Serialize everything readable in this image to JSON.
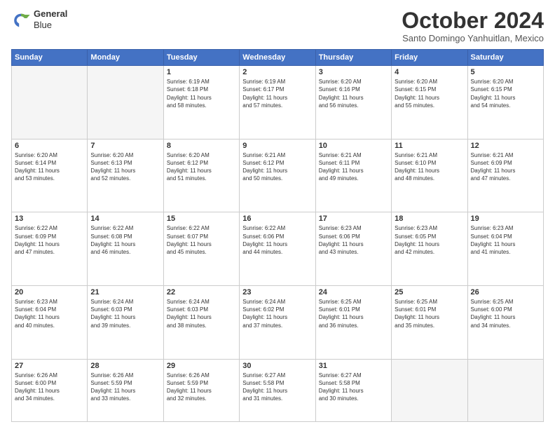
{
  "logo": {
    "line1": "General",
    "line2": "Blue"
  },
  "header": {
    "title": "October 2024",
    "subtitle": "Santo Domingo Yanhuitlan, Mexico"
  },
  "weekdays": [
    "Sunday",
    "Monday",
    "Tuesday",
    "Wednesday",
    "Thursday",
    "Friday",
    "Saturday"
  ],
  "weeks": [
    [
      {
        "day": "",
        "info": ""
      },
      {
        "day": "",
        "info": ""
      },
      {
        "day": "1",
        "info": "Sunrise: 6:19 AM\nSunset: 6:18 PM\nDaylight: 11 hours\nand 58 minutes."
      },
      {
        "day": "2",
        "info": "Sunrise: 6:19 AM\nSunset: 6:17 PM\nDaylight: 11 hours\nand 57 minutes."
      },
      {
        "day": "3",
        "info": "Sunrise: 6:20 AM\nSunset: 6:16 PM\nDaylight: 11 hours\nand 56 minutes."
      },
      {
        "day": "4",
        "info": "Sunrise: 6:20 AM\nSunset: 6:15 PM\nDaylight: 11 hours\nand 55 minutes."
      },
      {
        "day": "5",
        "info": "Sunrise: 6:20 AM\nSunset: 6:15 PM\nDaylight: 11 hours\nand 54 minutes."
      }
    ],
    [
      {
        "day": "6",
        "info": "Sunrise: 6:20 AM\nSunset: 6:14 PM\nDaylight: 11 hours\nand 53 minutes."
      },
      {
        "day": "7",
        "info": "Sunrise: 6:20 AM\nSunset: 6:13 PM\nDaylight: 11 hours\nand 52 minutes."
      },
      {
        "day": "8",
        "info": "Sunrise: 6:20 AM\nSunset: 6:12 PM\nDaylight: 11 hours\nand 51 minutes."
      },
      {
        "day": "9",
        "info": "Sunrise: 6:21 AM\nSunset: 6:12 PM\nDaylight: 11 hours\nand 50 minutes."
      },
      {
        "day": "10",
        "info": "Sunrise: 6:21 AM\nSunset: 6:11 PM\nDaylight: 11 hours\nand 49 minutes."
      },
      {
        "day": "11",
        "info": "Sunrise: 6:21 AM\nSunset: 6:10 PM\nDaylight: 11 hours\nand 48 minutes."
      },
      {
        "day": "12",
        "info": "Sunrise: 6:21 AM\nSunset: 6:09 PM\nDaylight: 11 hours\nand 47 minutes."
      }
    ],
    [
      {
        "day": "13",
        "info": "Sunrise: 6:22 AM\nSunset: 6:09 PM\nDaylight: 11 hours\nand 47 minutes."
      },
      {
        "day": "14",
        "info": "Sunrise: 6:22 AM\nSunset: 6:08 PM\nDaylight: 11 hours\nand 46 minutes."
      },
      {
        "day": "15",
        "info": "Sunrise: 6:22 AM\nSunset: 6:07 PM\nDaylight: 11 hours\nand 45 minutes."
      },
      {
        "day": "16",
        "info": "Sunrise: 6:22 AM\nSunset: 6:06 PM\nDaylight: 11 hours\nand 44 minutes."
      },
      {
        "day": "17",
        "info": "Sunrise: 6:23 AM\nSunset: 6:06 PM\nDaylight: 11 hours\nand 43 minutes."
      },
      {
        "day": "18",
        "info": "Sunrise: 6:23 AM\nSunset: 6:05 PM\nDaylight: 11 hours\nand 42 minutes."
      },
      {
        "day": "19",
        "info": "Sunrise: 6:23 AM\nSunset: 6:04 PM\nDaylight: 11 hours\nand 41 minutes."
      }
    ],
    [
      {
        "day": "20",
        "info": "Sunrise: 6:23 AM\nSunset: 6:04 PM\nDaylight: 11 hours\nand 40 minutes."
      },
      {
        "day": "21",
        "info": "Sunrise: 6:24 AM\nSunset: 6:03 PM\nDaylight: 11 hours\nand 39 minutes."
      },
      {
        "day": "22",
        "info": "Sunrise: 6:24 AM\nSunset: 6:03 PM\nDaylight: 11 hours\nand 38 minutes."
      },
      {
        "day": "23",
        "info": "Sunrise: 6:24 AM\nSunset: 6:02 PM\nDaylight: 11 hours\nand 37 minutes."
      },
      {
        "day": "24",
        "info": "Sunrise: 6:25 AM\nSunset: 6:01 PM\nDaylight: 11 hours\nand 36 minutes."
      },
      {
        "day": "25",
        "info": "Sunrise: 6:25 AM\nSunset: 6:01 PM\nDaylight: 11 hours\nand 35 minutes."
      },
      {
        "day": "26",
        "info": "Sunrise: 6:25 AM\nSunset: 6:00 PM\nDaylight: 11 hours\nand 34 minutes."
      }
    ],
    [
      {
        "day": "27",
        "info": "Sunrise: 6:26 AM\nSunset: 6:00 PM\nDaylight: 11 hours\nand 34 minutes."
      },
      {
        "day": "28",
        "info": "Sunrise: 6:26 AM\nSunset: 5:59 PM\nDaylight: 11 hours\nand 33 minutes."
      },
      {
        "day": "29",
        "info": "Sunrise: 6:26 AM\nSunset: 5:59 PM\nDaylight: 11 hours\nand 32 minutes."
      },
      {
        "day": "30",
        "info": "Sunrise: 6:27 AM\nSunset: 5:58 PM\nDaylight: 11 hours\nand 31 minutes."
      },
      {
        "day": "31",
        "info": "Sunrise: 6:27 AM\nSunset: 5:58 PM\nDaylight: 11 hours\nand 30 minutes."
      },
      {
        "day": "",
        "info": ""
      },
      {
        "day": "",
        "info": ""
      }
    ]
  ]
}
